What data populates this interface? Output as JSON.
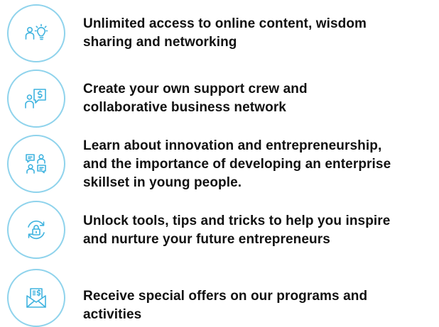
{
  "benefits": [
    {
      "icon": "people-lightbulb-icon",
      "lines": [
        "Unlimited access to online content, wisdom",
        "sharing and networking"
      ]
    },
    {
      "icon": "person-dollar-chat-icon",
      "lines": [
        "Create your own support crew and",
        "collaborative business network"
      ]
    },
    {
      "icon": "group-discussion-icon",
      "lines": [
        "Learn about innovation and entrepreneurship,",
        "and the importance of developing an enterprise",
        "skillset in young people."
      ]
    },
    {
      "icon": "lock-exchange-icon",
      "lines": [
        "Unlock tools, tips and tricks to help you inspire",
        "and nurture your future entrepreneurs"
      ]
    },
    {
      "icon": "envelope-offer-icon",
      "lines": [
        "Receive special offers on our programs and",
        "activities"
      ]
    }
  ],
  "colors": {
    "icon_stroke": "#3fb3df",
    "ring": "#8fd3ec",
    "text": "#111111"
  }
}
